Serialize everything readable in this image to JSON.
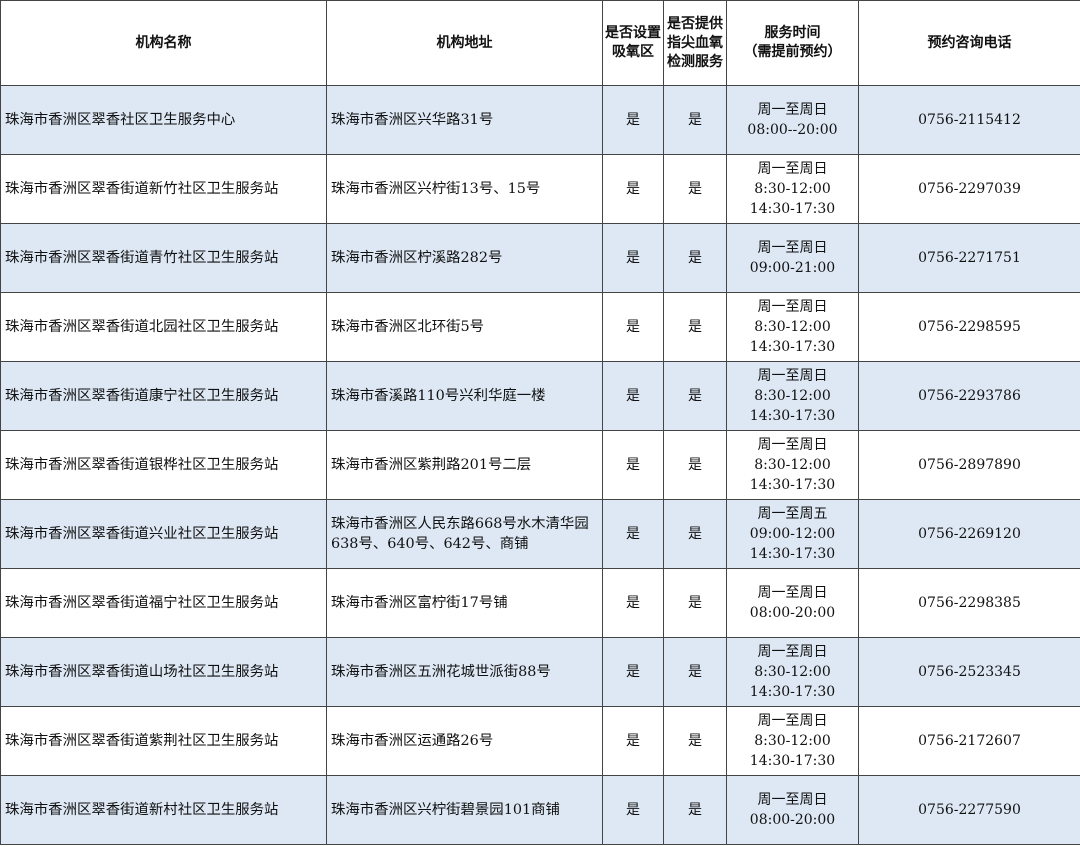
{
  "headers": {
    "name": "机构名称",
    "address": "机构地址",
    "oxygen_area": "是否设置吸氧区",
    "spo2_service": "是否提供指尖血氧检测服务",
    "service_time_1": "服务时间",
    "service_time_2": "（需提前预约）",
    "phone": "预约咨询电话"
  },
  "rows": [
    {
      "name": "珠海市香洲区翠香社区卫生服务中心",
      "address": "珠海市香洲区兴华路31号",
      "oxygen": "是",
      "spo2": "是",
      "time": [
        "周一至周日",
        "08:00--20:00"
      ],
      "phone": "0756-2115412"
    },
    {
      "name": "珠海市香洲区翠香街道新竹社区卫生服务站",
      "address": "珠海市香洲区兴柠街13号、15号",
      "oxygen": "是",
      "spo2": "是",
      "time": [
        "周一至周日",
        "8:30-12:00",
        "14:30-17:30"
      ],
      "phone": "0756-2297039"
    },
    {
      "name": "珠海市香洲区翠香街道青竹社区卫生服务站",
      "address": "珠海市香洲区柠溪路282号",
      "oxygen": "是",
      "spo2": "是",
      "time": [
        "周一至周日",
        "09:00-21:00"
      ],
      "phone": "0756-2271751"
    },
    {
      "name": "珠海市香洲区翠香街道北园社区卫生服务站",
      "address": "珠海市香洲区北环街5号",
      "oxygen": "是",
      "spo2": "是",
      "time": [
        "周一至周日",
        "8:30-12:00",
        "14:30-17:30"
      ],
      "phone": "0756-2298595"
    },
    {
      "name": "珠海市香洲区翠香街道康宁社区卫生服务站",
      "address": "珠海市香溪路110号兴利华庭一楼",
      "oxygen": "是",
      "spo2": "是",
      "time": [
        "周一至周日",
        "8:30-12:00",
        "14:30-17:30"
      ],
      "phone": "0756-2293786"
    },
    {
      "name": "珠海市香洲区翠香街道银桦社区卫生服务站",
      "address": "珠海市香洲区紫荆路201号二层",
      "oxygen": "是",
      "spo2": "是",
      "time": [
        "周一至周日",
        "8:30-12:00",
        "14:30-17:30"
      ],
      "phone": "0756-2897890"
    },
    {
      "name": "珠海市香洲区翠香街道兴业社区卫生服务站",
      "address": "珠海市香洲区人民东路668号水木清华园638号、640号、642号、商铺",
      "oxygen": "是",
      "spo2": "是",
      "time": [
        "周一至周五",
        "09:00-12:00",
        "14:30-17:30"
      ],
      "phone": "0756-2269120"
    },
    {
      "name": "珠海市香洲区翠香街道福宁社区卫生服务站",
      "address": "珠海市香洲区富柠街17号铺",
      "oxygen": "是",
      "spo2": "是",
      "time": [
        "周一至周日",
        "08:00-20:00"
      ],
      "phone": "0756-2298385"
    },
    {
      "name": "珠海市香洲区翠香街道山场社区卫生服务站",
      "address": "珠海市香洲区五洲花城世派街88号",
      "oxygen": "是",
      "spo2": "是",
      "time": [
        "周一至周日",
        "8:30-12:00",
        "14:30-17:30"
      ],
      "phone": "0756-2523345"
    },
    {
      "name": "珠海市香洲区翠香街道紫荆社区卫生服务站",
      "address": "珠海市香洲区运通路26号",
      "oxygen": "是",
      "spo2": "是",
      "time": [
        "周一至周日",
        "8:30-12:00",
        "14:30-17:30"
      ],
      "phone": "0756-2172607"
    },
    {
      "name": "珠海市香洲区翠香街道新村社区卫生服务站",
      "address": "珠海市香洲区兴柠街碧景园101商铺",
      "oxygen": "是",
      "spo2": "是",
      "time": [
        "周一至周日",
        "08:00-20:00"
      ],
      "phone": "0756-2277590"
    }
  ]
}
